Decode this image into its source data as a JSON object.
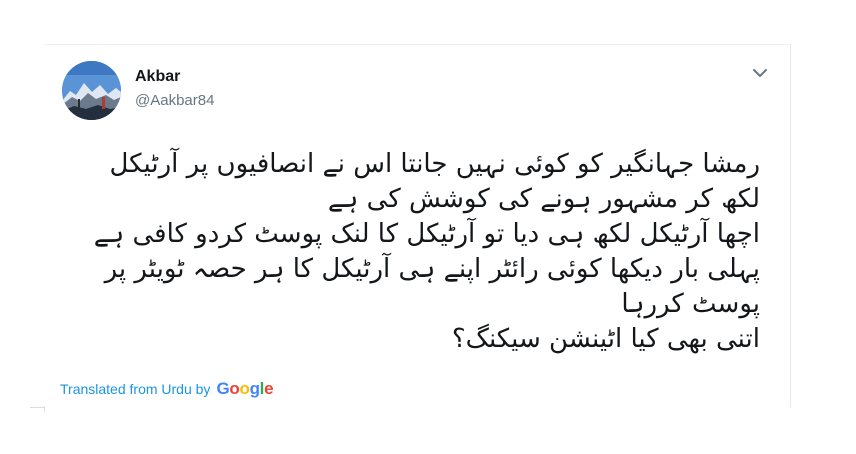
{
  "tweet": {
    "author_name": "Akbar",
    "author_handle": "@Aakbar84",
    "menu_icon": "chevron-down-icon",
    "avatar_icon": "avatar-mountain-photo",
    "text_lines": [
      "رمشا جہانگیر کو کوئی نہیں جانتا اس نے انصافیوں پر آرٹیکل",
      "لکھ کر مشہور ہونے کی کوشش کی ہے",
      "اچھا آرٹیکل لکھ ہی دیا تو آرٹیکل کا لنک پوسٹ کردو کافی ہے",
      "پہلی بار دیکھا کوئی رائٹر اپنے ہی آرٹیکل کا ہر حصہ ٹویٹر پر",
      "پوسٹ کررہا",
      "اتنی بھی کیا اٹینشن سیکنگ؟"
    ],
    "translation": {
      "label": "Translated from Urdu by",
      "brand_letters": [
        "G",
        "o",
        "o",
        "g",
        "l",
        "e"
      ],
      "brand_colors": [
        "#4285F4",
        "#EA4335",
        "#FBBC05",
        "#4285F4",
        "#34A853",
        "#EA4335"
      ]
    }
  }
}
